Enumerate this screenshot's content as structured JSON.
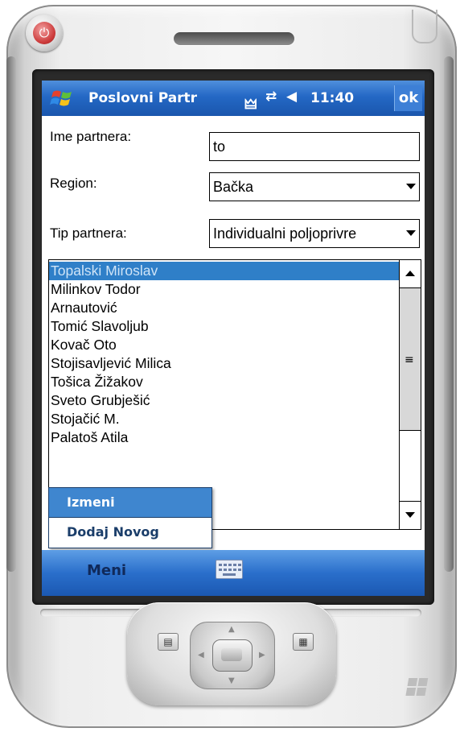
{
  "device": {
    "power_icon": "power-icon"
  },
  "titlebar": {
    "start_icon": "windows-flag-icon",
    "title": "Poslovni Partr",
    "signal_icon": "antenna-icon",
    "sync_icon": "sync-arrows-icon",
    "volume_icon": "speaker-icon",
    "time": "11:40",
    "ok_label": "ok"
  },
  "form": {
    "name_label": "Ime partnera:",
    "name_value": "to",
    "region_label": "Region:",
    "region_value": "Bačka",
    "type_label": "Tip partnera:",
    "type_value": "Individualni poljoprivre"
  },
  "partners": {
    "items": [
      "Topalski Miroslav",
      "Milinkov Todor",
      "Arnautović",
      "Tomić Slavoljub",
      "Kovač Oto",
      "Stojisavljević Milica",
      "Tošica Žižakov",
      "Sveto Grubješić",
      "Stojačić M.",
      "Palatoš Atila"
    ],
    "selected_index": 0
  },
  "context_menu": {
    "edit_label": "Izmeni",
    "add_label": "Dodaj Novog"
  },
  "softkeys": {
    "left_label": "Meni",
    "keyboard_icon": "keyboard-icon"
  },
  "colors": {
    "titlebar": "#2468c5",
    "selection": "#2f7fc8",
    "menu_highlight": "#3f86cf",
    "softkey_text": "#10295a"
  }
}
